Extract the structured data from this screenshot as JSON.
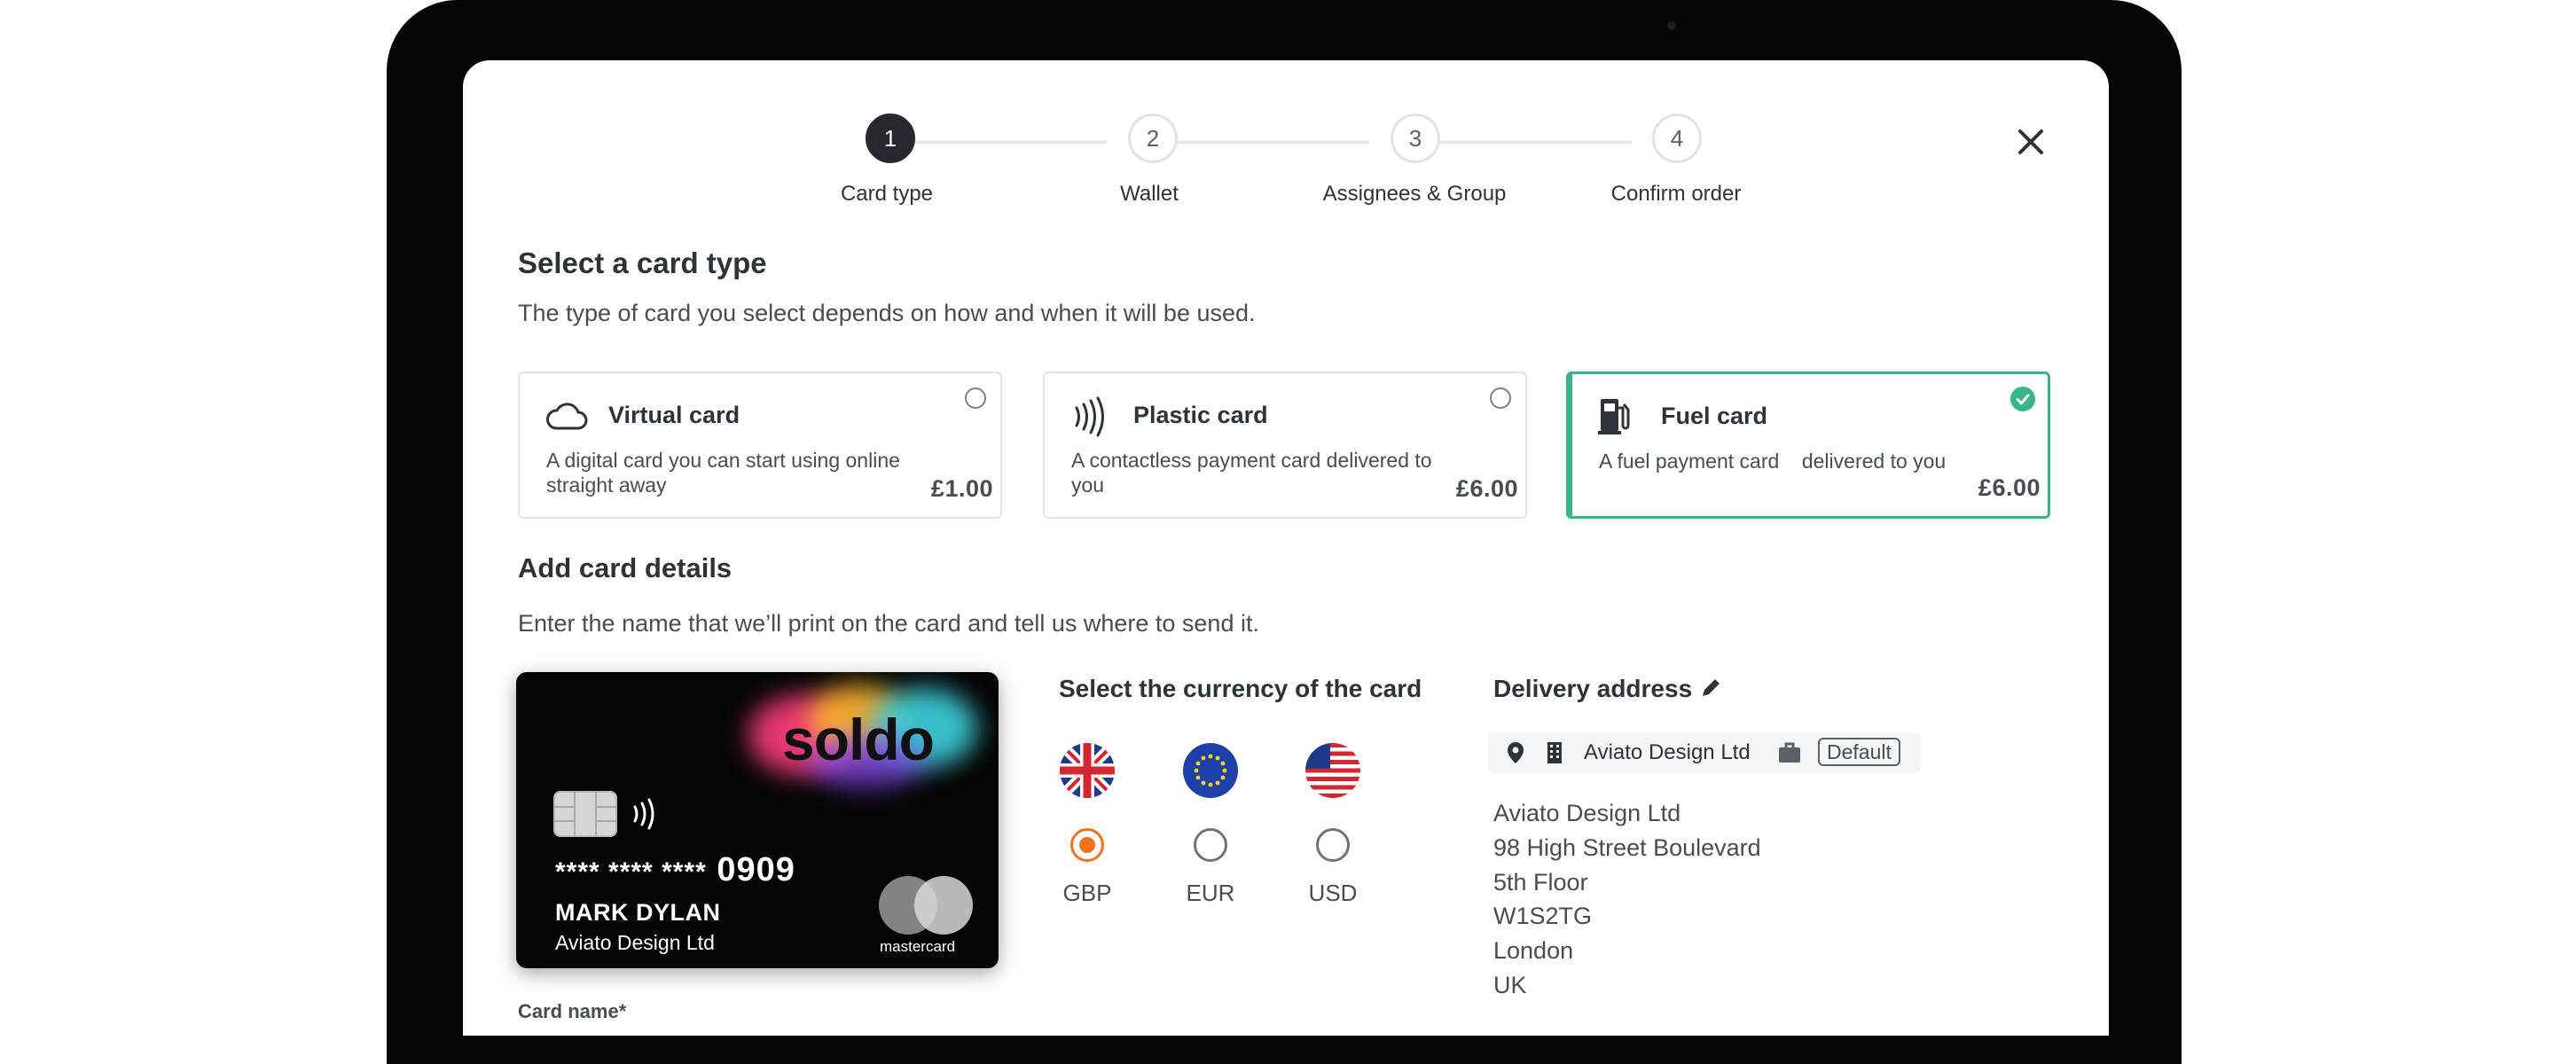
{
  "stepper": {
    "steps": [
      {
        "number": "1",
        "label": "Card type"
      },
      {
        "number": "2",
        "label": "Wallet"
      },
      {
        "number": "3",
        "label": "Assignees & Group"
      },
      {
        "number": "4",
        "label": "Confirm order"
      }
    ],
    "active_step": 1
  },
  "card_type": {
    "title": "Select a card type",
    "subtitle": "The type of card you select depends on how and when it will be used.",
    "options": [
      {
        "icon": "cloud-icon",
        "title": "Virtual card",
        "description": "A digital card you can start using online straight away",
        "price": "£1.00",
        "selected": false
      },
      {
        "icon": "contactless-icon",
        "title": "Plastic card",
        "description": "A contactless payment card delivered to you",
        "price": "£6.00",
        "selected": false
      },
      {
        "icon": "fuel-pump-icon",
        "title": "Fuel card",
        "description": "A fuel payment card    delivered to you",
        "price": "£6.00",
        "selected": true
      }
    ]
  },
  "card_details": {
    "title": "Add card details",
    "subtitle": "Enter the name that we’ll print on the card and tell us where to send it.",
    "preview": {
      "brand": "soldo",
      "masked_number": "**** **** ****",
      "last4": "0909",
      "holder": "MARK DYLAN",
      "company": "Aviato Design Ltd",
      "network": "mastercard"
    },
    "card_name_label": "Card name*"
  },
  "currency": {
    "title": "Select the currency of the card",
    "options": [
      {
        "code": "GBP",
        "flag": "uk-flag-icon",
        "selected": true
      },
      {
        "code": "EUR",
        "flag": "eu-flag-icon",
        "selected": false
      },
      {
        "code": "USD",
        "flag": "us-flag-icon",
        "selected": false
      }
    ]
  },
  "delivery": {
    "title": "Delivery address",
    "chip": {
      "name": "Aviato Design Ltd",
      "badge": "Default"
    },
    "address_lines": [
      "Aviato Design Ltd",
      "98 High Street Boulevard",
      "5th Floor",
      "W1S2TG",
      "London",
      "UK"
    ]
  },
  "colors": {
    "accent_selected": "#39b58b",
    "radio_selected": "#f2711c",
    "step_active": "#262a30"
  }
}
